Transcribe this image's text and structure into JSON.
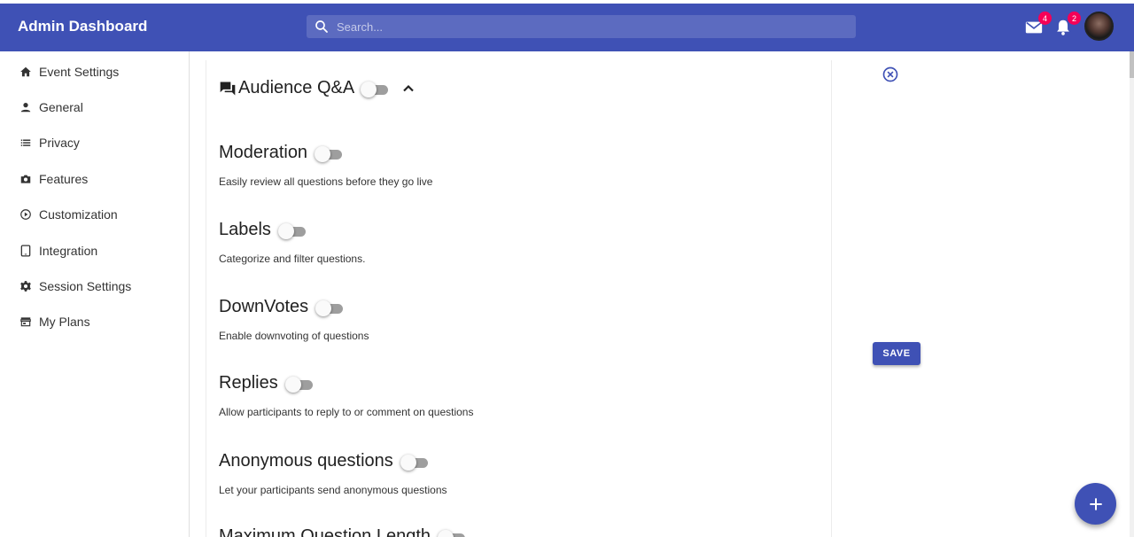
{
  "app": {
    "title": "Admin Dashboard"
  },
  "search": {
    "placeholder": "Search..."
  },
  "notifications": {
    "mail_count": "4",
    "bell_count": "2"
  },
  "sidebar": {
    "items": [
      {
        "label": "Event Settings",
        "icon": "home-icon"
      },
      {
        "label": "General",
        "icon": "person-icon"
      },
      {
        "label": "Privacy",
        "icon": "list-icon"
      },
      {
        "label": "Features",
        "icon": "camera-icon"
      },
      {
        "label": "Customization",
        "icon": "play-circle-icon"
      },
      {
        "label": "Integration",
        "icon": "tablet-icon"
      },
      {
        "label": "Session Settings",
        "icon": "gear-icon"
      },
      {
        "label": "My Plans",
        "icon": "store-icon"
      }
    ]
  },
  "main": {
    "section_title": "Audience Q&A",
    "section_enabled": false,
    "settings": [
      {
        "title": "Moderation",
        "description": "Easily review all questions before they go live",
        "enabled": false
      },
      {
        "title": "Labels",
        "description": "Categorize and filter questions.",
        "enabled": false
      },
      {
        "title": "DownVotes",
        "description": "Enable downvoting of questions",
        "enabled": false
      },
      {
        "title": "Replies",
        "description": "Allow participants to reply to or comment on questions",
        "enabled": false
      },
      {
        "title": "Anonymous questions",
        "description": "Let your participants send anonymous questions",
        "enabled": false
      },
      {
        "title": "Maximum Question Length",
        "description": "",
        "enabled": false
      }
    ]
  },
  "actions": {
    "save_label": "SAVE"
  },
  "colors": {
    "primary": "#3f51b5",
    "badge": "#f50057"
  }
}
